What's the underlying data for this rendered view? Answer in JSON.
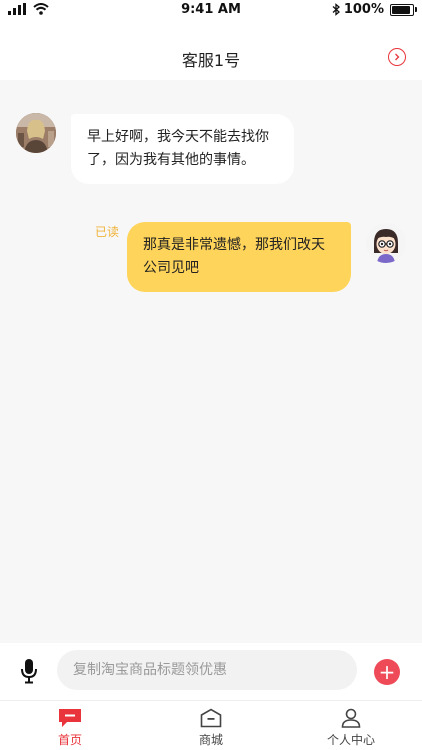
{
  "status_bar": {
    "time": "9:41 AM",
    "battery_text": "100%",
    "battery_level": 1.0
  },
  "nav": {
    "title": "客服1号",
    "right_icon": "chevron-right-circle-icon"
  },
  "messages": [
    {
      "side": "left",
      "text": "早上好啊，我今天不能去找你了，因为我有其他的事情。",
      "avatar_icon": "user-photo-avatar"
    },
    {
      "side": "right",
      "text": "那真是非常遗憾，那我们改天公司见吧",
      "status": "已读",
      "avatar_icon": "cartoon-girl-avatar"
    }
  ],
  "input": {
    "placeholder": "复制淘宝商品标题领优惠",
    "mic_icon": "microphone-icon",
    "add_icon": "plus-icon"
  },
  "tabs": [
    {
      "label": "首页",
      "icon": "chat-bubble-icon",
      "active": true
    },
    {
      "label": "商城",
      "icon": "shop-icon",
      "active": false
    },
    {
      "label": "个人中心",
      "icon": "user-icon",
      "active": false
    }
  ],
  "colors": {
    "accent": "#e8343a",
    "bubble_right": "#ffd45a",
    "read_status": "#f0b43a",
    "background": "#f7f7f7"
  }
}
